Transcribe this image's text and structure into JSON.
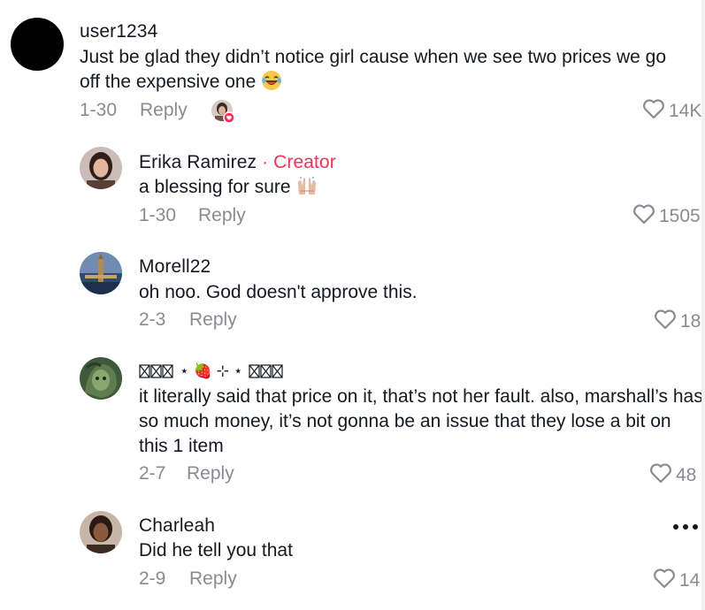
{
  "comments": [
    {
      "username": "user1234",
      "text": "Just be glad they didn’t notice girl cause when we see two prices we go off the expensive one",
      "date": "1-30",
      "reply": "Reply",
      "likes": "14K"
    },
    {
      "username": "Erika Ramirez",
      "creator_tag": " · Creator",
      "text": "a blessing for sure",
      "date": "1-30",
      "reply": "Reply",
      "likes": "1505"
    },
    {
      "username": "Morell22",
      "text": "oh noo. God doesn't approve this.",
      "date": "2-3",
      "reply": "Reply",
      "likes": "18"
    },
    {
      "username": "⋆ 🍓 ⊹ ⋆",
      "text": "it literally said that price on it, that’s not her fault. also, marshall’s has so much money, it’s not gonna be an issue that they lose a bit on this 1 item",
      "date": "2-7",
      "reply": "Reply",
      "likes": "48"
    },
    {
      "username": "Charleah",
      "text": "Did he tell you that",
      "date": "2-9",
      "reply": "Reply",
      "likes": "14"
    }
  ],
  "colors": {
    "text": "#161823",
    "muted": "#8a8b91",
    "creator": "#fe2c55"
  },
  "icons": {
    "like": "heart-outline-icon",
    "more": "more-dots-icon",
    "laugh": "laughing-emoji",
    "pray": "praying-hands-emoji"
  }
}
